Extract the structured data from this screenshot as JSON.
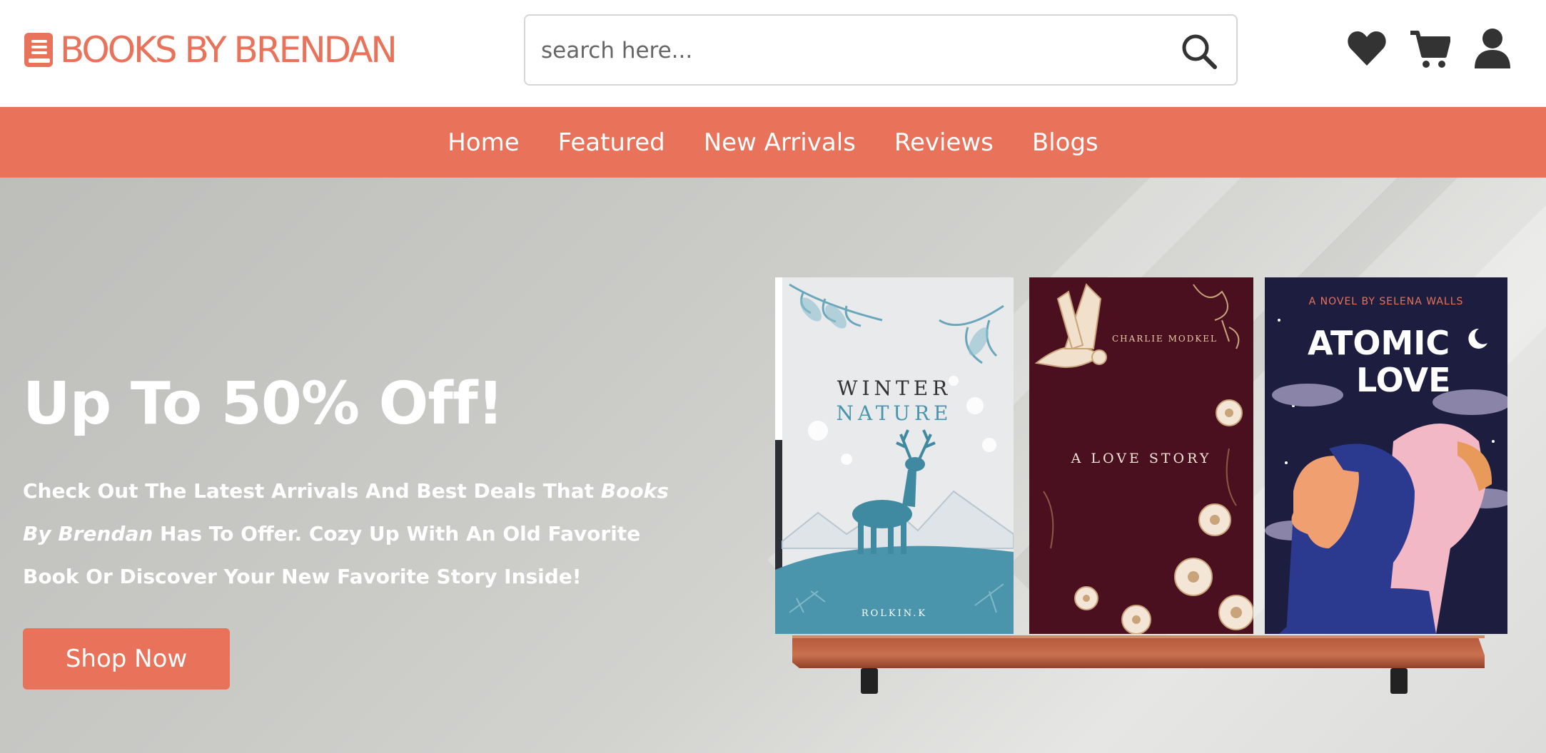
{
  "brand": {
    "name": "BOOKS BY BRENDAN",
    "accent_color": "#e8735a",
    "icon": "book-icon"
  },
  "search": {
    "placeholder": "search here...",
    "value": "",
    "icon": "search-icon"
  },
  "header_icons": [
    "heart-icon",
    "cart-icon",
    "user-icon"
  ],
  "nav": {
    "items": [
      {
        "label": "Home"
      },
      {
        "label": "Featured"
      },
      {
        "label": "New Arrivals"
      },
      {
        "label": "Reviews"
      },
      {
        "label": "Blogs"
      }
    ]
  },
  "hero": {
    "title": "Up To 50% Off!",
    "desc_part1": "Check Out The Latest Arrivals And Best Deals That ",
    "desc_brand": "Books By Brendan",
    "desc_part2": " Has To Offer. Cozy Up With An Old Favorite Book Or Discover Your New Favorite Story Inside!",
    "button_label": "Shop Now"
  },
  "books": [
    {
      "title_line1": "WINTER",
      "title_line2": "NATURE",
      "author": "ROLKIN.K",
      "cover_color": "#e9eaec",
      "accent": "#4b95ac"
    },
    {
      "author": "CHARLIE MODKEL",
      "title": "A LOVE STORY",
      "cover_color": "#4a1020",
      "accent": "#e7c9a3"
    },
    {
      "subtitle": "A NOVEL BY SELENA WALLS",
      "title_line1": "ATOMIC",
      "title_line2": "LOVE",
      "cover_color": "#1c1d3f",
      "accent": "#e8735a"
    }
  ]
}
